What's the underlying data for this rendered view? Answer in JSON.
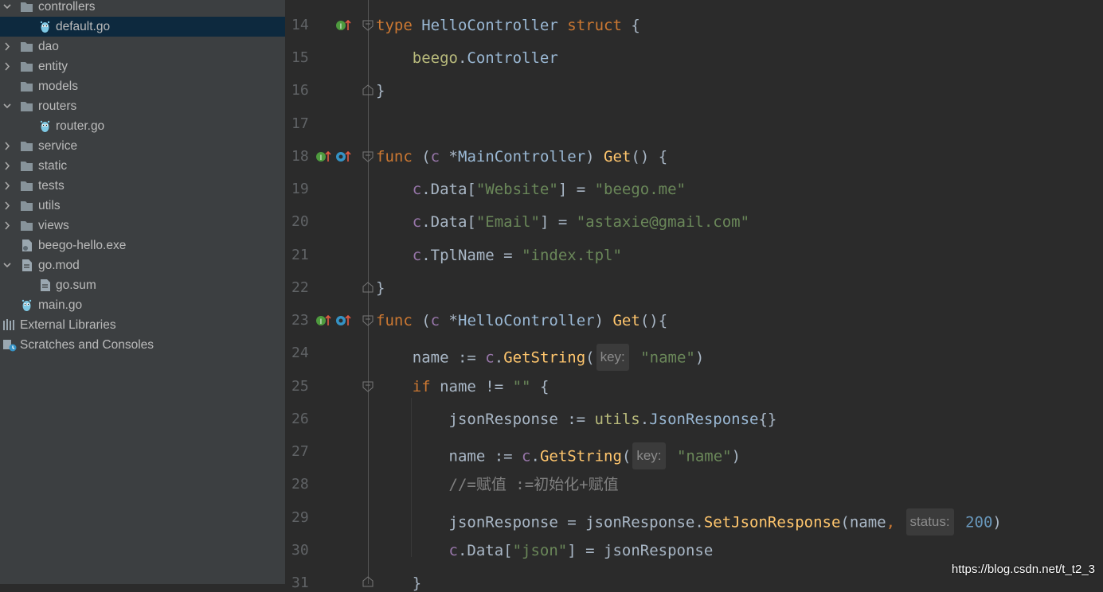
{
  "colors": {
    "sidebar_bg": "#3c3f41",
    "selected_row": "#0d293e",
    "editor_bg": "#2b2b2b",
    "keyword": "#cc7832",
    "string": "#6a8759",
    "function": "#ffc66d",
    "line_number": "#606366"
  },
  "project_tree": [
    {
      "label": "controllers",
      "type": "folder",
      "expanded": true,
      "icon": "folder-icon"
    },
    {
      "label": "default.go",
      "type": "go-file",
      "selected": true,
      "icon": "gopher-icon"
    },
    {
      "label": "dao",
      "type": "folder",
      "expanded": false,
      "icon": "folder-icon"
    },
    {
      "label": "entity",
      "type": "folder",
      "expanded": false,
      "icon": "folder-icon"
    },
    {
      "label": "models",
      "type": "folder",
      "icon": "folder-icon"
    },
    {
      "label": "routers",
      "type": "folder",
      "expanded": true,
      "icon": "folder-icon"
    },
    {
      "label": "router.go",
      "type": "go-file",
      "icon": "gopher-icon"
    },
    {
      "label": "service",
      "type": "folder",
      "expanded": false,
      "icon": "folder-icon"
    },
    {
      "label": "static",
      "type": "folder",
      "expanded": false,
      "icon": "folder-icon"
    },
    {
      "label": "tests",
      "type": "folder",
      "expanded": false,
      "icon": "folder-icon"
    },
    {
      "label": "utils",
      "type": "folder",
      "expanded": false,
      "icon": "folder-icon"
    },
    {
      "label": "views",
      "type": "folder",
      "expanded": false,
      "icon": "folder-icon"
    },
    {
      "label": "beego-hello.exe",
      "type": "exe",
      "icon": "executable-icon"
    },
    {
      "label": "go.mod",
      "type": "mod",
      "expanded": true,
      "icon": "file-icon"
    },
    {
      "label": "go.sum",
      "type": "file",
      "icon": "file-icon"
    },
    {
      "label": "main.go",
      "type": "go-file",
      "icon": "gopher-icon"
    },
    {
      "label": "External Libraries",
      "type": "libs",
      "icon": "libraries-icon"
    },
    {
      "label": "Scratches and Consoles",
      "type": "scratch",
      "icon": "scratches-icon"
    }
  ],
  "editor": {
    "lines": [
      {
        "num": "14",
        "text": "type HelloController struct {"
      },
      {
        "num": "15",
        "text": "    beego.Controller"
      },
      {
        "num": "16",
        "text": "}"
      },
      {
        "num": "17",
        "text": ""
      },
      {
        "num": "18",
        "text": "func (c *MainController) Get() {"
      },
      {
        "num": "19",
        "text": "    c.Data[\"Website\"] = \"beego.me\""
      },
      {
        "num": "20",
        "text": "    c.Data[\"Email\"] = \"astaxie@gmail.com\""
      },
      {
        "num": "21",
        "text": "    c.TplName = \"index.tpl\""
      },
      {
        "num": "22",
        "text": "}"
      },
      {
        "num": "23",
        "text": "func (c *HelloController) Get(){"
      },
      {
        "num": "24",
        "text": "    name := c.GetString(key: \"name\")"
      },
      {
        "num": "25",
        "text": "    if name != \"\" {"
      },
      {
        "num": "26",
        "text": "        jsonResponse := utils.JsonResponse{}"
      },
      {
        "num": "27",
        "text": "        name := c.GetString(key: \"name\")"
      },
      {
        "num": "28",
        "text": "        //=赋值 :=初始化+赋值"
      },
      {
        "num": "29",
        "text": "        jsonResponse = jsonResponse.SetJsonResponse(name, status: 200)"
      },
      {
        "num": "30",
        "text": "        c.Data[\"json\"] = jsonResponse"
      },
      {
        "num": "31",
        "text": "    }"
      }
    ],
    "gutter_icons": {
      "implements": "implements-icon",
      "method": "method-icon",
      "fold": "fold-icon"
    }
  },
  "watermark": "https://blog.csdn.net/t_t2_3"
}
